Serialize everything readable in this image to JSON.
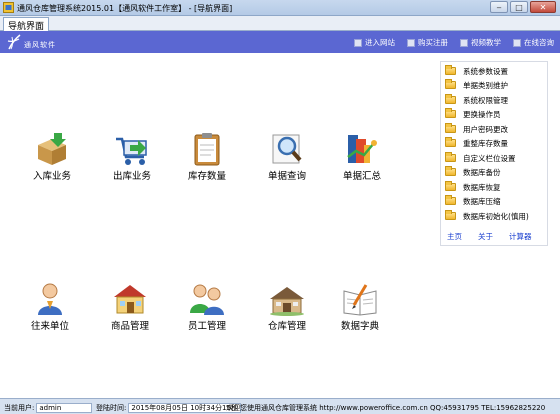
{
  "window": {
    "title": "通风仓库管理系统2015.01【通风软件工作室】 - [导航界面]",
    "min_label": "‒",
    "max_label": "□",
    "close_label": "✕"
  },
  "tab": {
    "label": "导航界面"
  },
  "brand": {
    "text": "通风软件"
  },
  "navlinks": [
    {
      "label": "进入网站"
    },
    {
      "label": "购买注册"
    },
    {
      "label": "视频教学"
    },
    {
      "label": "在线咨询"
    }
  ],
  "functions": [
    {
      "label": "入库业务",
      "icon": "box-in-icon"
    },
    {
      "label": "出库业务",
      "icon": "cart-out-icon"
    },
    {
      "label": "库存数量",
      "icon": "clipboard-icon"
    },
    {
      "label": "单据查询",
      "icon": "magnifier-icon"
    },
    {
      "label": "单据汇总",
      "icon": "books-chart-icon"
    },
    {
      "label": "往来单位",
      "icon": "person-icon"
    },
    {
      "label": "商品管理",
      "icon": "shop-icon"
    },
    {
      "label": "员工管理",
      "icon": "people-icon"
    },
    {
      "label": "仓库管理",
      "icon": "warehouse-icon"
    },
    {
      "label": "数据字典",
      "icon": "dictionary-icon"
    }
  ],
  "panel": {
    "items": [
      "系统参数设置",
      "单据类别维护",
      "系统权限管理",
      "更换操作员",
      "用户密码更改",
      "重整库存数量",
      "自定义栏位设置",
      "数据库备份",
      "数据库恢复",
      "数据库压缩",
      "数据库初始化(慎用)"
    ],
    "links": [
      "主页",
      "关于",
      "计算器"
    ]
  },
  "status": {
    "user_label": "当前用户:",
    "user_value": "admin",
    "time_label": "登陆时间:",
    "time_value": "2015年08月05日 10时34分15秒",
    "message": "欢迎您使用通风仓库管理系统 http://www.poweroffice.com.cn QQ:45931795 TEL:15962825220"
  },
  "colors": {
    "nav_bar": "#5b67d2",
    "link": "#1a3fcf",
    "status_bar": "#d6e1f0"
  }
}
